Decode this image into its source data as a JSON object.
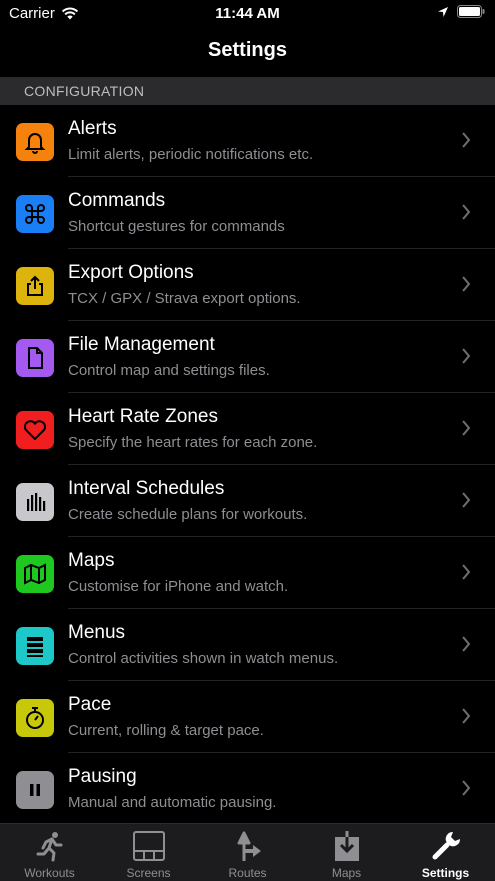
{
  "status_bar": {
    "carrier": "Carrier",
    "time": "11:44 AM"
  },
  "nav": {
    "title": "Settings"
  },
  "section": {
    "header": "CONFIGURATION"
  },
  "items": [
    {
      "title": "Alerts",
      "subtitle": "Limit alerts, periodic notifications etc.",
      "icon": "bell-icon",
      "color": "#f5820c"
    },
    {
      "title": "Commands",
      "subtitle": "Shortcut gestures for commands",
      "icon": "command-icon",
      "color": "#1a7ff5"
    },
    {
      "title": "Export Options",
      "subtitle": "TCX / GPX / Strava export options.",
      "icon": "share-icon",
      "color": "#dcb40c"
    },
    {
      "title": "File Management",
      "subtitle": "Control map and settings files.",
      "icon": "document-icon",
      "color": "#a45af0"
    },
    {
      "title": "Heart Rate Zones",
      "subtitle": "Specify the heart rates for each zone.",
      "icon": "heart-icon",
      "color": "#f01e1e"
    },
    {
      "title": "Interval Schedules",
      "subtitle": "Create schedule plans for workouts.",
      "icon": "bars-icon",
      "color": "#c8c8cc"
    },
    {
      "title": "Maps",
      "subtitle": "Customise for iPhone and watch.",
      "icon": "map-icon",
      "color": "#1ec81e"
    },
    {
      "title": "Menus",
      "subtitle": "Control activities shown in watch menus.",
      "icon": "menu-icon",
      "color": "#1ec8c8"
    },
    {
      "title": "Pace",
      "subtitle": "Current, rolling & target pace.",
      "icon": "stopwatch-icon",
      "color": "#c8c80a"
    },
    {
      "title": "Pausing",
      "subtitle": "Manual and automatic pausing.",
      "icon": "pause-icon",
      "color": "#8e8e93"
    }
  ],
  "tabs": [
    {
      "label": "Workouts",
      "icon": "runner-icon",
      "active": false
    },
    {
      "label": "Screens",
      "icon": "screens-icon",
      "active": false
    },
    {
      "label": "Routes",
      "icon": "route-icon",
      "active": false
    },
    {
      "label": "Maps",
      "icon": "download-icon",
      "active": false
    },
    {
      "label": "Settings",
      "icon": "wrench-icon",
      "active": true
    }
  ]
}
